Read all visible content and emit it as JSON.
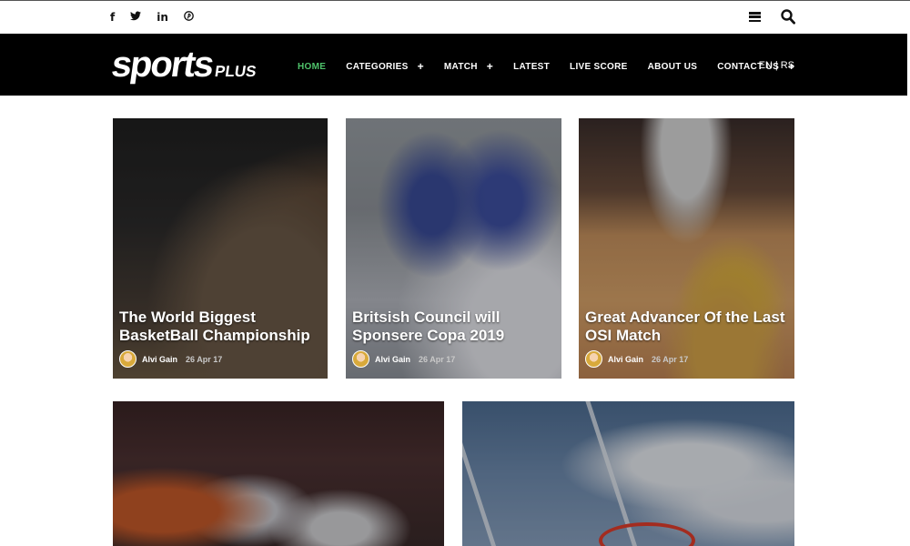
{
  "topbar": {
    "social": [
      {
        "icon": "facebook-icon",
        "glyph": "f"
      },
      {
        "icon": "twitter-icon",
        "glyph": "𝕥"
      },
      {
        "icon": "linkedin-icon",
        "glyph": "in"
      },
      {
        "icon": "pinterest-icon",
        "glyph": "℗"
      }
    ]
  },
  "brand": {
    "logo_main": "sports",
    "logo_sub": "PLUS"
  },
  "nav": {
    "items": [
      {
        "label": "HOME",
        "active": true,
        "has_submenu": false
      },
      {
        "label": "CATEGORIES",
        "active": false,
        "has_submenu": true
      },
      {
        "label": "MATCH",
        "active": false,
        "has_submenu": true
      },
      {
        "label": "LATEST",
        "active": false,
        "has_submenu": false
      },
      {
        "label": "LIVE SCORE",
        "active": false,
        "has_submenu": false
      },
      {
        "label": "ABOUT US",
        "active": false,
        "has_submenu": false
      },
      {
        "label": "CONTACT US",
        "active": false,
        "has_submenu": true
      }
    ],
    "submenu_symbol": "+",
    "language": {
      "en": "EN",
      "sep": "|",
      "rs": "RS"
    }
  },
  "posts": [
    {
      "title": "The World Biggest BasketBall Championship",
      "author": "Alvi Gain",
      "date": "26 Apr 17"
    },
    {
      "title": "Britsish Council will Sponsere Copa 2019",
      "author": "Alvi Gain",
      "date": "26 Apr 17"
    },
    {
      "title": "Great Advancer Of the Last OSI Match",
      "author": "Alvi Gain",
      "date": "26 Apr 17"
    }
  ],
  "colors": {
    "accent": "#4fc36b",
    "nav_bg": "#000000"
  }
}
